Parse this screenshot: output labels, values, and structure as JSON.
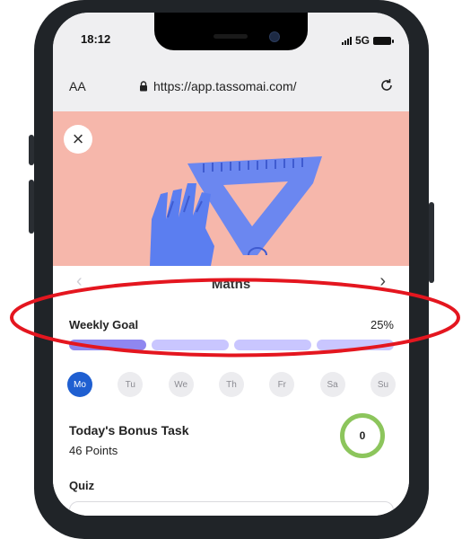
{
  "status_bar": {
    "time": "18:12",
    "network": "5G"
  },
  "browser": {
    "text_size_label": "AA",
    "url": "https://app.tassomai.com/"
  },
  "hero": {
    "close_glyph": "×"
  },
  "subject": {
    "title": "Maths",
    "prev_glyph": "‹",
    "next_glyph": "›"
  },
  "weekly_goal": {
    "label": "Weekly Goal",
    "percent_text": "25%",
    "progress": 0.25
  },
  "days": [
    {
      "label": "Mo",
      "active": true
    },
    {
      "label": "Tu",
      "active": false
    },
    {
      "label": "We",
      "active": false
    },
    {
      "label": "Th",
      "active": false
    },
    {
      "label": "Fr",
      "active": false
    },
    {
      "label": "Sa",
      "active": false
    },
    {
      "label": "Su",
      "active": false
    }
  ],
  "bonus_task": {
    "title": "Today's Bonus Task",
    "points": "46 Points",
    "count": "0"
  },
  "quiz": {
    "label": "Quiz"
  },
  "colors": {
    "hero_bg": "#f6b7ab",
    "progress_filled": "#8f87f0",
    "progress_empty": "#c9c6ff",
    "active_day": "#1f5fd1",
    "bonus_ring": "#8cc55c",
    "annotation": "#e4161f"
  }
}
